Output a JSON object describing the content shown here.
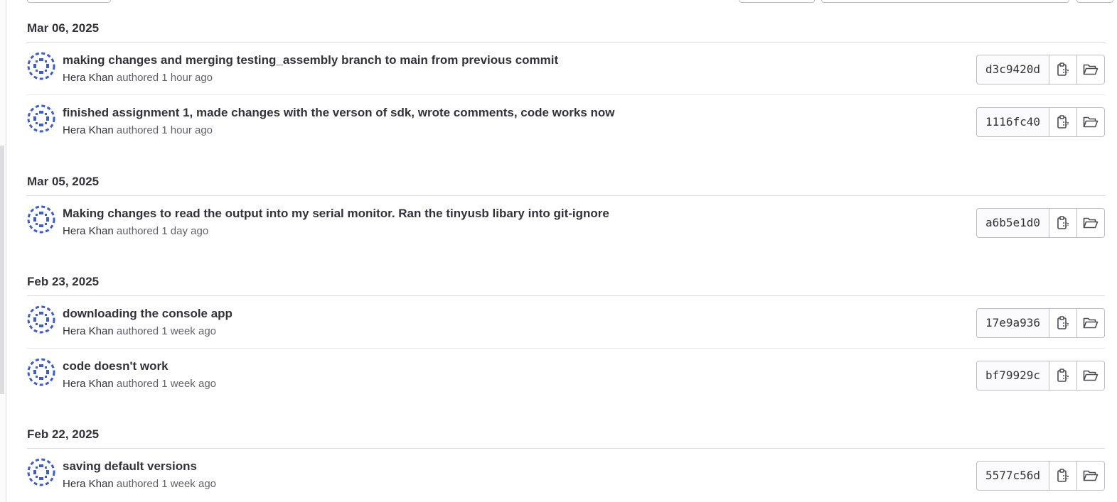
{
  "colors": {
    "avatar_blue": "#3b5bdb",
    "text_primary": "#333238",
    "text_secondary": "#626168",
    "border": "#bfbfc3"
  },
  "days": [
    {
      "date": "Mar 06, 2025",
      "commits": [
        {
          "title": "making changes and merging testing_assembly branch to main from previous commit",
          "author": "Hera Khan",
          "authored_label": "authored",
          "time": "1 hour ago",
          "sha": "d3c9420d"
        },
        {
          "title": "finished assignment 1, made changes with the verson of sdk, wrote comments, code works now",
          "author": "Hera Khan",
          "authored_label": "authored",
          "time": "1 hour ago",
          "sha": "1116fc40"
        }
      ]
    },
    {
      "date": "Mar 05, 2025",
      "commits": [
        {
          "title": "Making changes to read the output into my serial monitor. Ran the tinyusb libary into git-ignore",
          "author": "Hera Khan",
          "authored_label": "authored",
          "time": "1 day ago",
          "sha": "a6b5e1d0"
        }
      ]
    },
    {
      "date": "Feb 23, 2025",
      "commits": [
        {
          "title": "downloading the console app",
          "author": "Hera Khan",
          "authored_label": "authored",
          "time": "1 week ago",
          "sha": "17e9a936"
        },
        {
          "title": "code doesn't work",
          "author": "Hera Khan",
          "authored_label": "authored",
          "time": "1 week ago",
          "sha": "bf79929c"
        }
      ]
    },
    {
      "date": "Feb 22, 2025",
      "commits": [
        {
          "title": "saving default versions",
          "author": "Hera Khan",
          "authored_label": "authored",
          "time": "1 week ago",
          "sha": "5577c56d"
        }
      ]
    }
  ]
}
